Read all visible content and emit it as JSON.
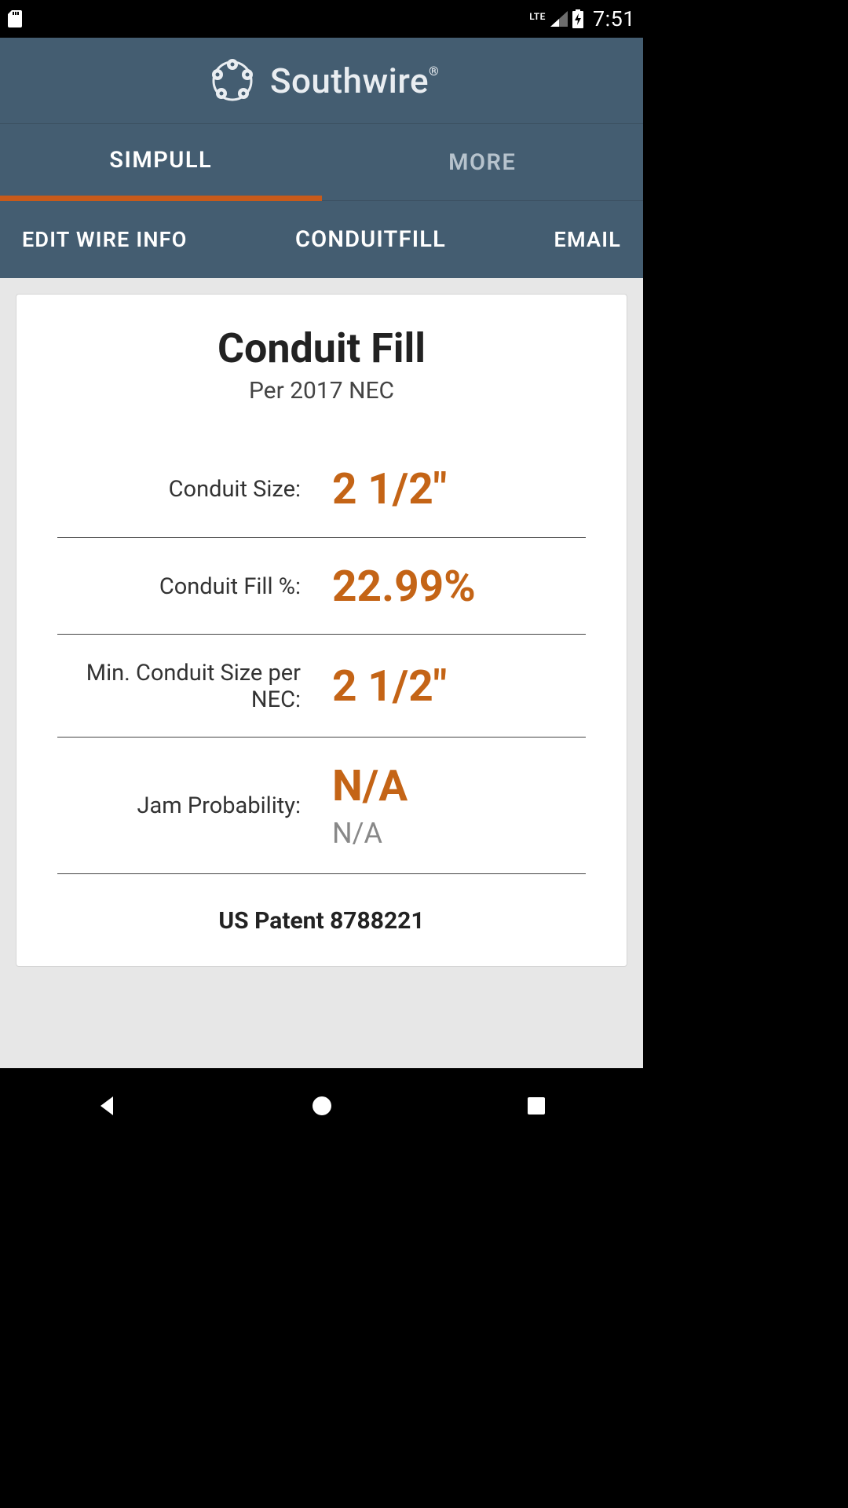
{
  "status": {
    "network": "LTE",
    "time": "7:51"
  },
  "brand": {
    "name": "Southwire"
  },
  "tabs": {
    "simpull": "SIMPULL",
    "more": "MORE"
  },
  "actions": {
    "edit": "EDIT WIRE INFO",
    "center": "CONDUITFILL",
    "email": "EMAIL"
  },
  "card": {
    "title": "Conduit Fill",
    "subtitle": "Per 2017 NEC",
    "rows": {
      "conduit_size": {
        "label": "Conduit Size:",
        "value": "2 1/2\""
      },
      "fill_pct": {
        "label": "Conduit Fill %:",
        "value": "22.99%"
      },
      "min_size": {
        "label": "Min. Conduit Size per NEC:",
        "value": "2 1/2\""
      },
      "jam": {
        "label": "Jam Probability:",
        "value": "N/A",
        "sub": "N/A"
      }
    },
    "patent": "US Patent 8788221"
  },
  "colors": {
    "header_bg": "#445d71",
    "accent": "#c85a1a",
    "value": "#c46416"
  }
}
